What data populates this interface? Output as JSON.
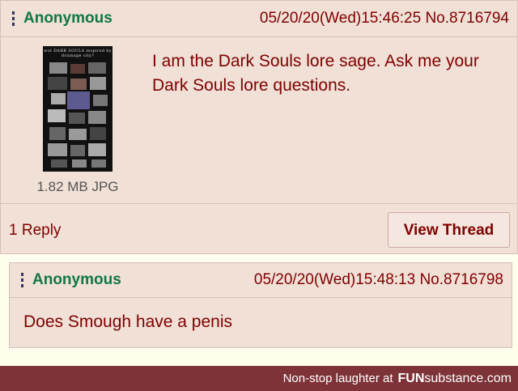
{
  "op": {
    "name": "Anonymous",
    "postinfo": "05/20/20(Wed)15:46:25 No.8716794",
    "text": "I am the Dark Souls lore sage. Ask me your Dark Souls lore questions.",
    "thumb_caption": "wot  DARK SOULS inspired by drainage city?",
    "filesize": "1.82 MB JPG",
    "reply_count": "1 Reply",
    "view_thread_label": "View Thread"
  },
  "reply": {
    "name": "Anonymous",
    "postinfo": "05/20/20(Wed)15:48:13 No.8716798",
    "text": "Does Smough have a penis"
  },
  "banner": {
    "text": "Non-stop laughter at",
    "brand_bold": "FUN",
    "brand_rest": "substance.com"
  },
  "colors": {
    "post_bg": "#f0e0d6",
    "name_green": "#117743",
    "text_maroon": "#800000",
    "banner_bg": "#7d3338"
  }
}
